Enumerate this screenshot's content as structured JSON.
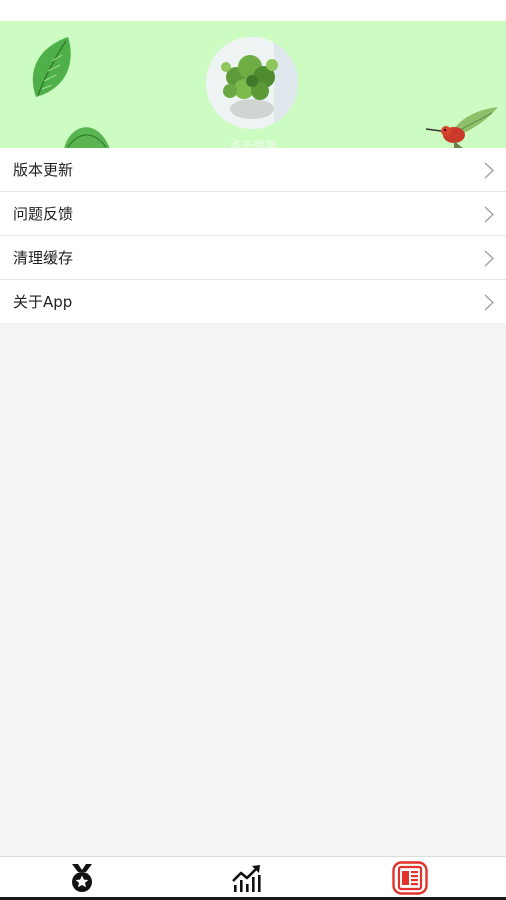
{
  "header": {
    "nickname": "点击登录"
  },
  "menu": {
    "items": [
      {
        "label": "版本更新"
      },
      {
        "label": "问题反馈"
      },
      {
        "label": "清理缓存"
      },
      {
        "label": "关于App"
      }
    ]
  },
  "tabbar": {
    "tabs": [
      {
        "icon": "medal-icon",
        "active": false
      },
      {
        "icon": "chart-icon",
        "active": false
      },
      {
        "icon": "news-icon",
        "active": true
      }
    ]
  },
  "colors": {
    "header_bg": "#ccfcc1",
    "active_tab": "#e0332c",
    "inactive_tab": "#111111"
  }
}
